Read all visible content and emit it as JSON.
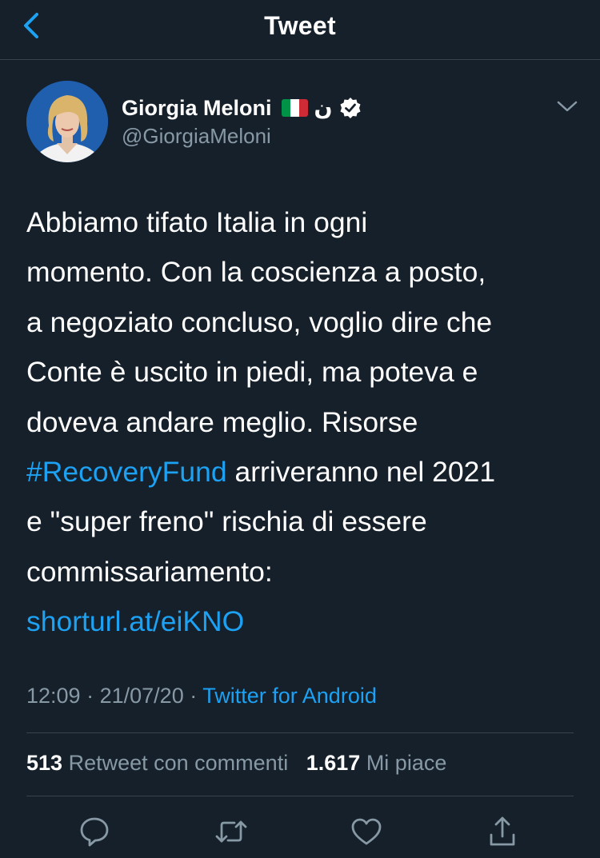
{
  "header": {
    "title": "Tweet",
    "back_icon": "chevron-left-icon"
  },
  "author": {
    "display_name": "Giorgia Meloni",
    "flag": "italian-flag",
    "name_suffix": "ن",
    "verified": true,
    "handle": "@GiorgiaMeloni"
  },
  "tweet": {
    "lines": [
      "Abbiamo tifato Italia in ogni",
      "momento. Con la coscienza a posto,",
      "a negoziato concluso, voglio dire che",
      "Conte è uscito in piedi, ma poteva e",
      "doveva andare meglio. Risorse",
      "arriveranno nel 2021",
      "e \"super freno\" rischia di essere",
      "commissariamento:"
    ],
    "hashtag": "#RecoveryFund",
    "url": "shorturl.at/eiKNO"
  },
  "meta": {
    "time": "12:09",
    "sep1": "·",
    "date": "21/07/20",
    "sep2": "·",
    "source": "Twitter for Android"
  },
  "stats": {
    "retweets_count": "513",
    "retweets_label": "Retweet con commenti",
    "likes_count": "1.617",
    "likes_label": "Mi piace"
  },
  "actions": [
    "reply-icon",
    "retweet-icon",
    "like-icon",
    "share-icon"
  ],
  "colors": {
    "background": "#15202b",
    "link": "#1da1f2",
    "secondary_text": "#8899a6",
    "divider": "#38444d"
  }
}
